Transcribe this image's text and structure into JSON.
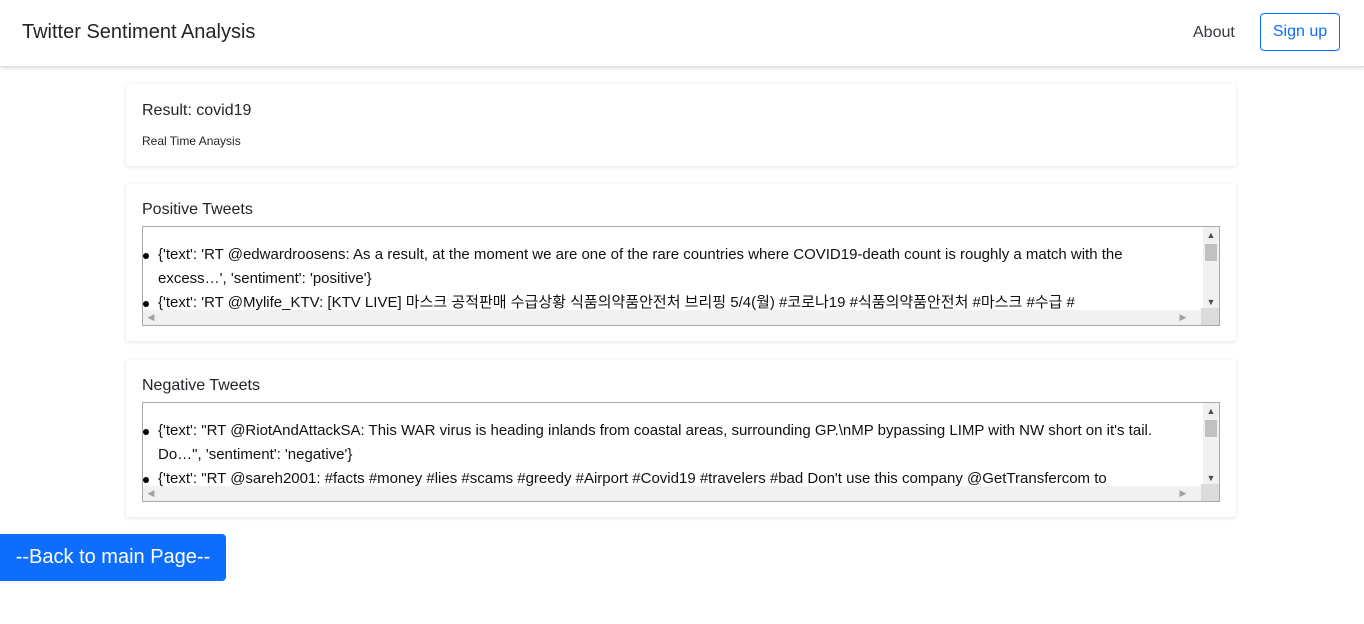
{
  "navbar": {
    "brand": "Twitter Sentiment Analysis",
    "about": "About",
    "signup": "Sign up"
  },
  "result": {
    "title": "Result: covid19",
    "subtitle": "Real Time Anaysis"
  },
  "positive": {
    "label": "Positive Tweets",
    "tweets": [
      "{'text': 'RT @edwardroosens: As a result, at the moment we are one of the rare countries where COVID19-death count is roughly a match with the excess…', 'sentiment': 'positive'}",
      "{'text': 'RT @Mylife_KTV: [KTV LIVE] 마스크 공적판매 수급상황 식품의약품안전처 브리핑 5/4(월) #코로나19 #식품의약품안전처 #마스크 #수급 #"
    ]
  },
  "negative": {
    "label": "Negative Tweets",
    "tweets": [
      "{'text': \"RT @RiotAndAttackSA: This WAR virus is heading inlands from coastal areas, surrounding GP.\\nMP bypassing LIMP with NW short on it's tail. Do…\", 'sentiment': 'negative'}",
      "{'text': \"RT @sareh2001: #facts #money #lies #scams #greedy #Airport #Covid19 #travelers #bad Don't use this company @GetTransfercom to"
    ]
  },
  "back_button": "--Back to main Page--",
  "colors": {
    "primary": "#0d6efd"
  }
}
